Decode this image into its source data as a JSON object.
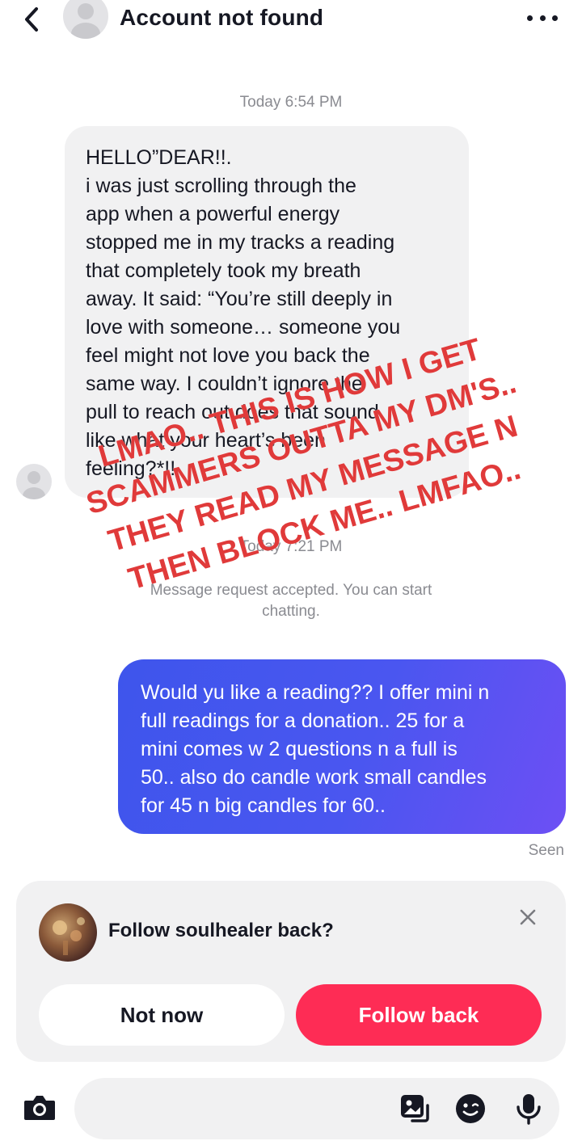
{
  "header": {
    "title": "Account not found",
    "back_icon": "chevron-left-icon",
    "more_icon": "more-horizontal-icon"
  },
  "messages": {
    "timestamp_1": "Today 6:54 PM",
    "incoming_text": "HELLO”DEAR!!.\ni was just scrolling through the\napp when a powerful energy\nstopped me in my tracks a reading\nthat completely took my breath\naway. It said: “You’re still deeply in\nlove with someone… someone you\nfeel might not love you back the\nsame way. I couldn’t ignore the\npull to reach out does that sound\nlike what your heart’s been\nfeeling?*!!",
    "timestamp_2": "Today 7:21 PM",
    "system_text": "Message request accepted. You can start chatting.",
    "outgoing_text": "Would yu like a reading?? I offer mini n\nfull readings for a donation.. 25 for a\nmini comes w 2 questions n a full is\n50.. also do candle work small candles\nfor 45 n big candles for 60..",
    "seen_label": "Seen"
  },
  "overlay": {
    "caption": "LMAO.. THIS IS HOW I GET SCAMMERS OUTTA MY DM'S.. THEY READ MY MESSAGE N THEN BLOCK ME.. LMFAO..",
    "color": "#e03a3a"
  },
  "follow_card": {
    "prompt": "Follow soulhealer back?",
    "not_now_label": "Not now",
    "follow_back_label": "Follow back",
    "accent": "#fe2c55"
  },
  "composer": {
    "placeholder": "",
    "icons": [
      "camera-icon",
      "photo-sticker-icon",
      "emoji-icon",
      "microphone-icon"
    ]
  },
  "colors": {
    "outgoing_bubble": "#4a56f0",
    "incoming_bubble": "#f1f1f2",
    "muted_text": "#8a8b91"
  }
}
